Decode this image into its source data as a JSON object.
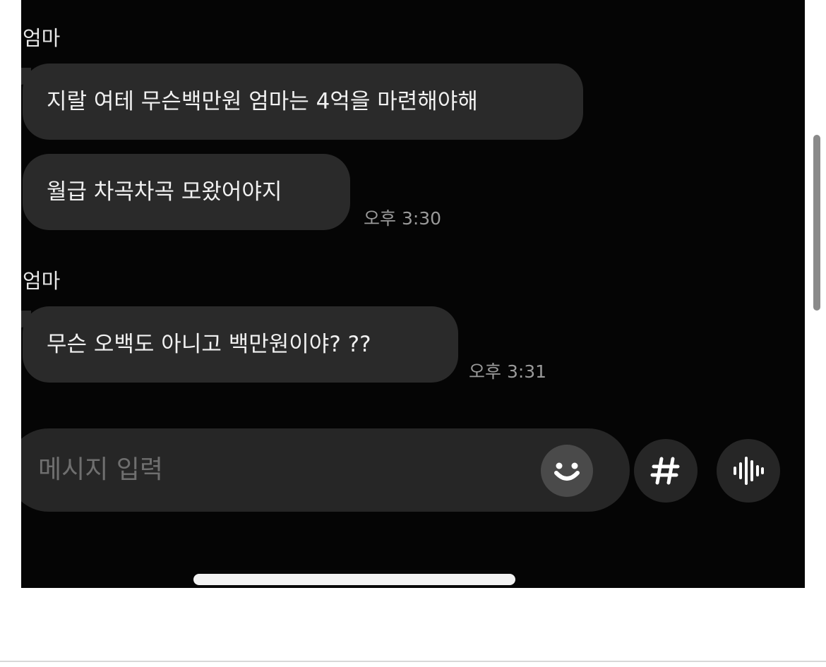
{
  "chat": {
    "groups": [
      {
        "sender": "엄마",
        "messages": [
          {
            "text": "지랄 여테 무슨백만원 엄마는 4억을 마련해야해",
            "time": ""
          },
          {
            "text": "월급 차곡차곡 모왔어야지",
            "time": "오후 3:30"
          }
        ]
      },
      {
        "sender": "엄마",
        "messages": [
          {
            "text": "무슨 오백도 아니고 백만원이야? ??",
            "time": "오후 3:31"
          }
        ]
      }
    ]
  },
  "composer": {
    "placeholder": "메시지 입력",
    "emoji_icon": "emoji-smile-icon",
    "hashtag_icon": "hashtag-icon",
    "voice_icon": "voice-waveform-icon"
  },
  "colors": {
    "background": "#050505",
    "bubble": "#2a2a2a",
    "text": "#f1f1f1",
    "timestamp": "#9a9a9a",
    "placeholder": "#6f6f6f"
  }
}
